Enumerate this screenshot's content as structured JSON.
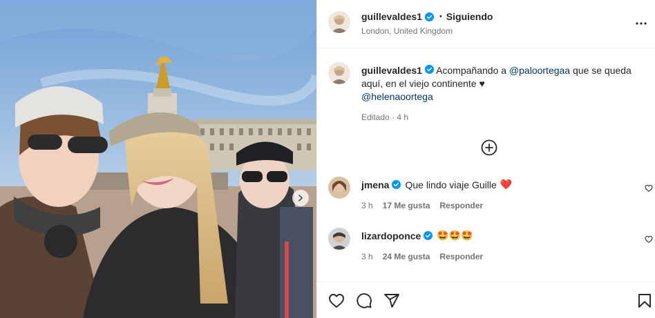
{
  "post": {
    "author": {
      "username": "guillevaldes1",
      "verified": true,
      "follow_status": "Siguiendo",
      "separator": "•",
      "location": "London, United Kingdom",
      "avatar_icon": "profile-photo"
    },
    "caption": {
      "username": "guillevaldes1",
      "text_before": "Acompañando a",
      "mention_1": "@paloortegaa",
      "text_after": "que se queda aquí, en el viejo continente ♥",
      "mention_2": "@helenaoortega",
      "edited_label": "Editado · 4 h"
    },
    "load_more_icon": "plus-circle-icon",
    "more_options_icon": "more-horizontal-icon",
    "photo": {
      "carousel_next_icon": "chevron-right-icon"
    }
  },
  "comments": [
    {
      "username": "jmena",
      "verified": true,
      "text": "Que lindo viaje Guille",
      "emoji": "❤️",
      "time": "3 h",
      "likes": "17 Me gusta",
      "reply_label": "Responder"
    },
    {
      "username": "lizardoponce",
      "verified": true,
      "text": "",
      "emoji": "🤩🤩🤩",
      "time": "3 h",
      "likes": "24 Me gusta",
      "reply_label": "Responder"
    }
  ],
  "actions": {
    "like_icon": "heart-icon",
    "comment_icon": "comment-icon",
    "share_icon": "share-icon",
    "save_icon": "bookmark-icon"
  },
  "colors": {
    "text": "#262626",
    "secondary": "#737373",
    "link": "#00376b",
    "verified": "#0095f6",
    "border": "#efefef"
  }
}
